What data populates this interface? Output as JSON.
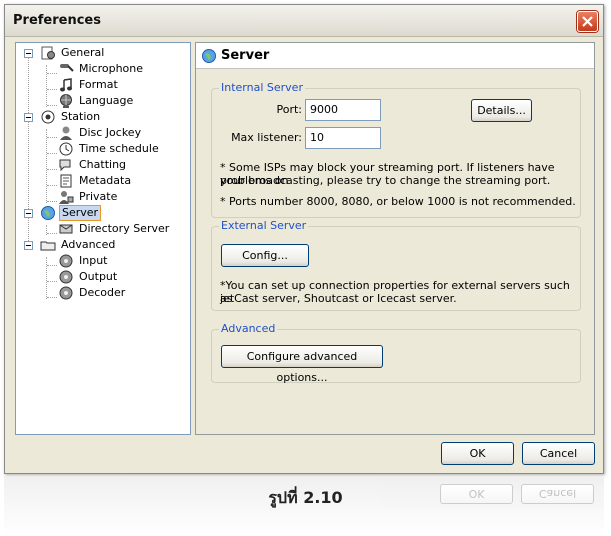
{
  "window": {
    "title": "Preferences"
  },
  "tree": {
    "items": [
      {
        "label": "General",
        "icon": "general-icon"
      },
      {
        "label": "Microphone",
        "icon": "microphone-icon"
      },
      {
        "label": "Format",
        "icon": "music-note-icon"
      },
      {
        "label": "Language",
        "icon": "globe-icon"
      },
      {
        "label": "Station",
        "icon": "station-icon"
      },
      {
        "label": "Disc Jockey",
        "icon": "dj-icon"
      },
      {
        "label": "Time schedule",
        "icon": "clock-icon"
      },
      {
        "label": "Chatting",
        "icon": "chat-icon"
      },
      {
        "label": "Metadata",
        "icon": "metadata-icon"
      },
      {
        "label": "Private",
        "icon": "private-icon"
      },
      {
        "label": "Server",
        "icon": "server-globe-icon"
      },
      {
        "label": "Directory Server",
        "icon": "directory-icon"
      },
      {
        "label": "Advanced",
        "icon": "advanced-icon"
      },
      {
        "label": "Input",
        "icon": "input-icon"
      },
      {
        "label": "Output",
        "icon": "output-icon"
      },
      {
        "label": "Decoder",
        "icon": "decoder-icon"
      }
    ],
    "selected": "Server"
  },
  "panel": {
    "title": "Server",
    "internal": {
      "title": "Internal Server",
      "port_label": "Port:",
      "port_value": "9000",
      "max_label": "Max listener:",
      "max_value": "10",
      "details_button": "Details...",
      "note1_line1": "* Some ISPs may block your streaming port. If listeners have problems on",
      "note1_line2": "your broadcasting, please try to change the streaming port.",
      "note2": "* Ports number 8000, 8080, or below 1000 is not recommended."
    },
    "external": {
      "title": "External Server",
      "config_button": "Config...",
      "note_line1": "*You can set up connection properties for external servers such as",
      "note_line2": "jetCast server, Shoutcast or Icecast server."
    },
    "advanced": {
      "title": "Advanced",
      "button": "Configure advanced options..."
    }
  },
  "footer": {
    "ok": "OK",
    "cancel": "Cancel"
  },
  "caption": "รูปที่ 2.10",
  "colors": {
    "group_title": "#1f50c8",
    "selection_border": "#e9962c",
    "button_border": "#003c74"
  }
}
